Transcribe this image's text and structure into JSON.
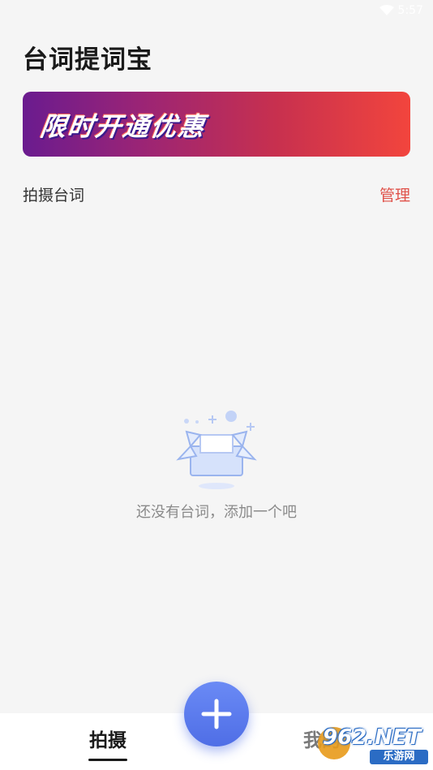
{
  "status_bar": {
    "time": "5:57",
    "wifi_icon": "wifi-icon"
  },
  "app": {
    "title": "台词提词宝"
  },
  "promo": {
    "text": "限时开通优惠"
  },
  "section": {
    "title": "拍摄台词",
    "manage_label": "管理"
  },
  "empty_state": {
    "icon": "open-box-icon",
    "message": "还没有台词，添加一个吧"
  },
  "bottom_nav": {
    "items": [
      {
        "label": "拍摄",
        "active": true
      },
      {
        "label": "我的",
        "active": false
      }
    ],
    "add_icon": "plus-icon"
  },
  "watermark": {
    "main": "962.NET",
    "sub": "乐游网"
  },
  "colors": {
    "accent": "#e0524a",
    "fab": "#5b7cf0",
    "banner_start": "#6a1b8f",
    "banner_end": "#f2453d"
  }
}
